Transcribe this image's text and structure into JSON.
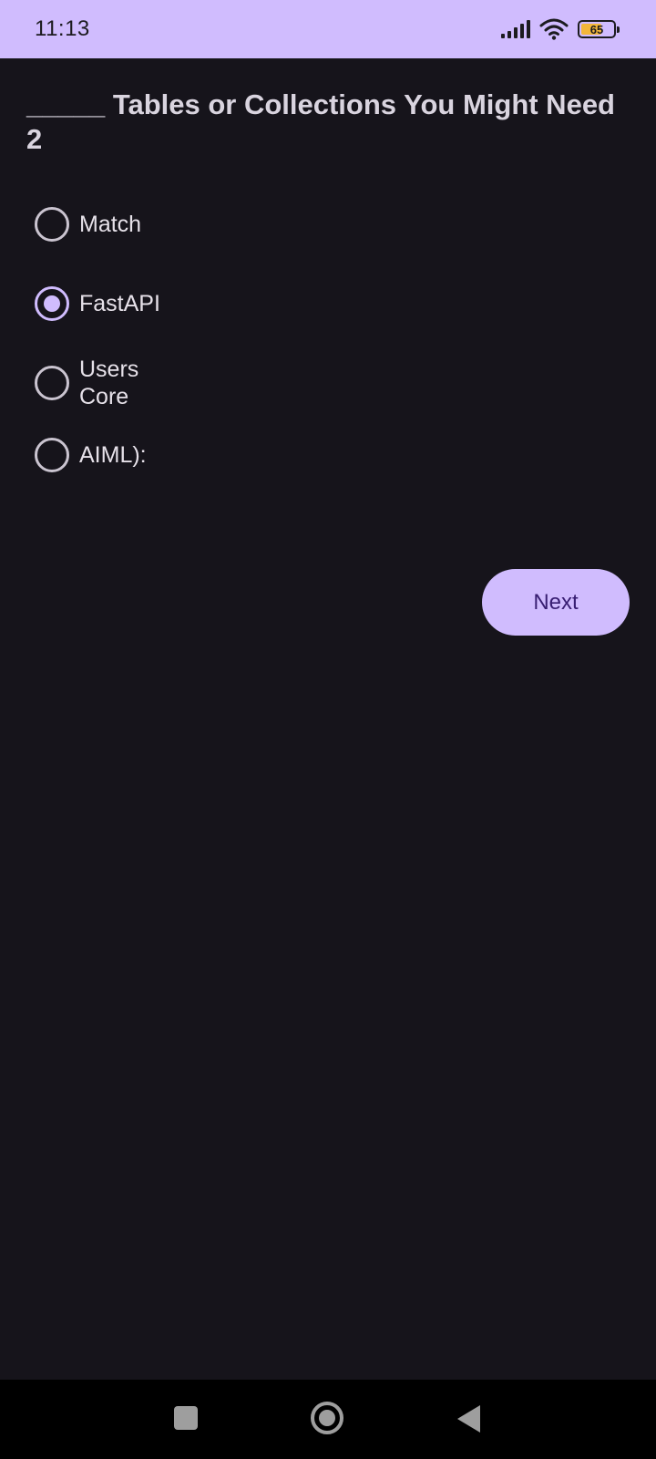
{
  "status_bar": {
    "time": "11:13",
    "battery_level": "65",
    "battery_fraction": 0.65,
    "icons": [
      "signal-icon",
      "wifi-icon",
      "battery-icon"
    ]
  },
  "question": {
    "text": "_____ Tables or Collections You Might Need 2"
  },
  "options": [
    {
      "label": "Match",
      "selected": false
    },
    {
      "label": "FastAPI",
      "selected": true
    },
    {
      "label": "Users\nCore",
      "selected": false
    },
    {
      "label": "AIML):",
      "selected": false
    }
  ],
  "next_button": {
    "label": "Next"
  },
  "nav_bar": {
    "icons": [
      "recents-icon",
      "home-icon",
      "back-icon"
    ]
  },
  "colors": {
    "accent": "#d0bcfe",
    "background": "#16141b",
    "on_accent": "#381e72",
    "battery": "#f3b63a"
  }
}
